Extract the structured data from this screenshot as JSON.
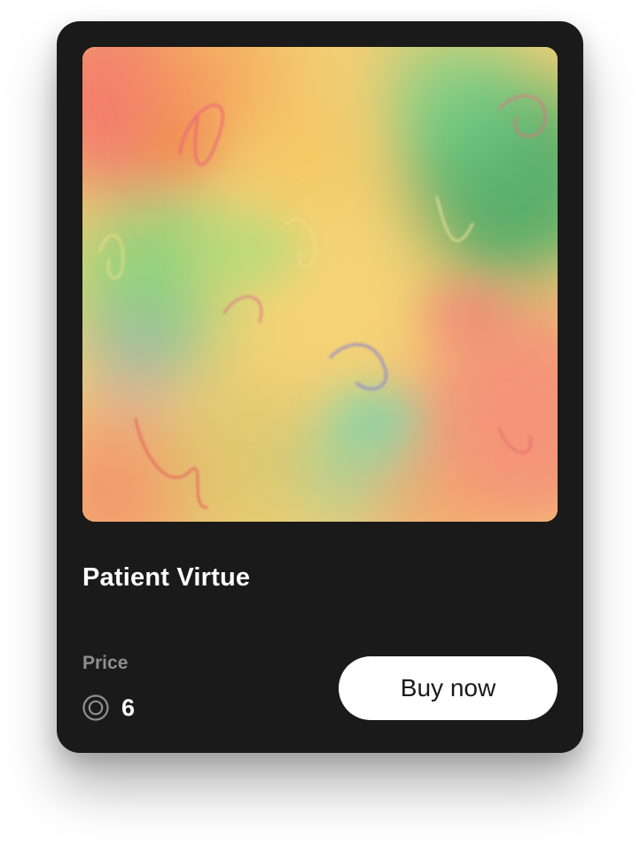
{
  "card": {
    "title": "Patient Virtue",
    "price_label": "Price",
    "price_value": "6",
    "currency_icon": "coin-icon",
    "buy_label": "Buy now",
    "artwork_alt": ""
  },
  "colors": {
    "card_bg": "#1a1a1a",
    "button_bg": "#ffffff",
    "title_text": "#ffffff",
    "muted_text": "#8e8e8e"
  }
}
